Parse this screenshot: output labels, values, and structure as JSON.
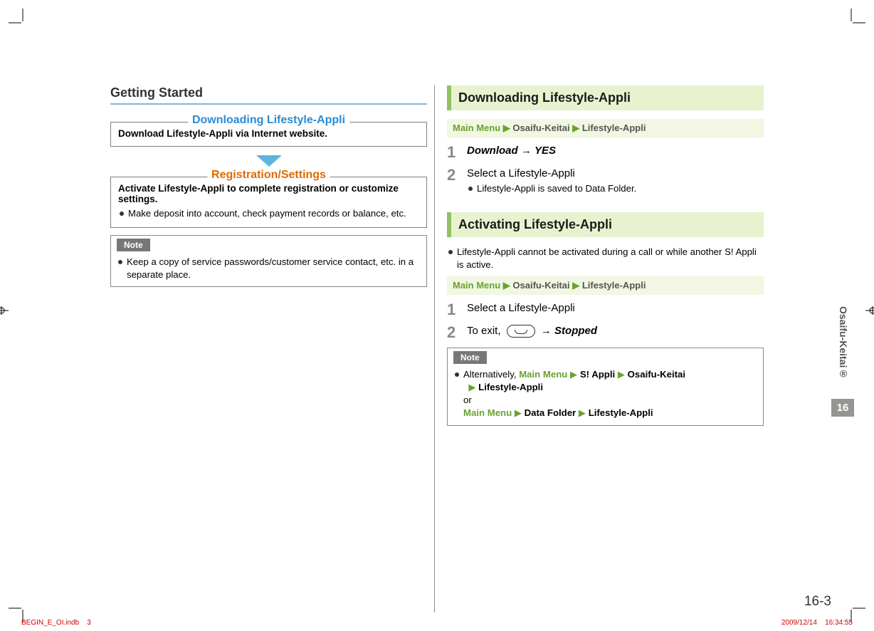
{
  "left": {
    "h1": "Getting Started",
    "box1": {
      "title": "Downloading Lifestyle-Appli",
      "text": "Download Lifestyle-Appli via Internet website."
    },
    "box2": {
      "title": "Registration/Settings",
      "text": "Activate Lifestyle-Appli to complete registration or customize settings.",
      "bullets": [
        "Make deposit into account, check payment records or balance, etc."
      ]
    },
    "note": {
      "tag": "Note",
      "bullets": [
        "Keep a copy of service passwords/customer service contact, etc. in a separate place."
      ]
    }
  },
  "right": {
    "nav": {
      "mainmenu": "Main Menu",
      "osaifu": "Osaifu-Keitai",
      "lifestyle": "Lifestyle-Appli"
    },
    "section1": {
      "title": "Downloading Lifestyle-Appli",
      "steps": [
        {
          "n": "1",
          "a": "Download",
          "b": "YES"
        },
        {
          "n": "2",
          "text": "Select a Lifestyle-Appli",
          "bullet": "Lifestyle-Appli is saved to Data Folder."
        }
      ]
    },
    "section2": {
      "title": "Activating Lifestyle-Appli",
      "intro": "Lifestyle-Appli cannot be activated during a call or while another S! Appli is active.",
      "steps": [
        {
          "n": "1",
          "text": "Select a Lifestyle-Appli"
        },
        {
          "n": "2",
          "pre": "To exit,",
          "post": "Stopped"
        }
      ]
    },
    "note": {
      "tag": "Note",
      "alt": "Alternatively, ",
      "sappli": "S! Appli",
      "or": "or",
      "datafolder": "Data Folder"
    }
  },
  "side": {
    "tab": "Osaifu-Keitai®",
    "chapter": "16"
  },
  "footer": {
    "pagenum": "16-3",
    "file": "BEGIN_E_OI.indb",
    "sheet": "3",
    "date": "2009/12/14",
    "time": "16:34:55"
  }
}
